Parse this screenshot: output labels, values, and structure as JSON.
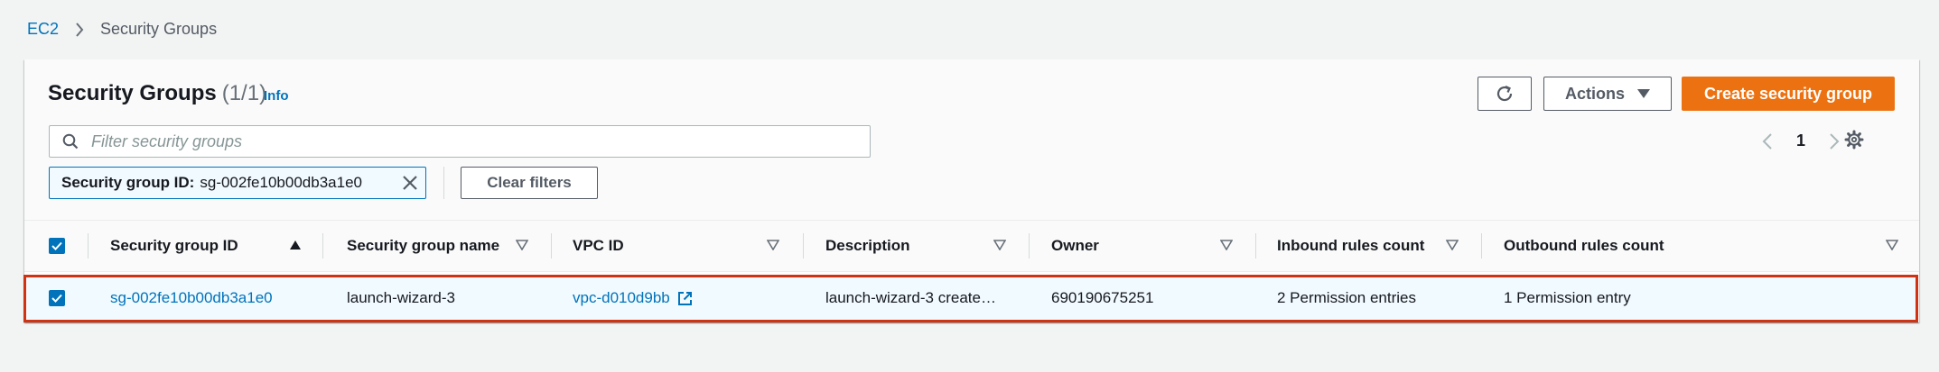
{
  "breadcrumb": {
    "root": "EC2",
    "current": "Security Groups"
  },
  "header": {
    "title": "Security Groups",
    "count": "(1/1)",
    "info": "Info",
    "actions_label": "Actions",
    "create_label": "Create security group"
  },
  "search": {
    "placeholder": "Filter security groups",
    "value": ""
  },
  "pagination": {
    "current_page": "1"
  },
  "filter_token": {
    "key": "Security group ID:",
    "value": "sg-002fe10b00db3a1e0"
  },
  "clear_filters_label": "Clear filters",
  "table": {
    "columns": [
      "Security group ID",
      "Security group name",
      "VPC ID",
      "Description",
      "Owner",
      "Inbound rules count",
      "Outbound rules count"
    ],
    "sorted_column": "Security group ID",
    "sort_direction": "ascending",
    "rows": [
      {
        "selected": true,
        "security_group_id": "sg-002fe10b00db3a1e0",
        "security_group_name": "launch-wizard-3",
        "vpc_id": "vpc-d010d9bb",
        "description": "launch-wizard-3 create…",
        "owner": "690190675251",
        "inbound_rules_count": "2 Permission entries",
        "outbound_rules_count": "1 Permission entry"
      }
    ]
  },
  "colors": {
    "link": "#0073bb",
    "primary": "#ec7211",
    "selection_border": "#d13212",
    "selected_row_bg": "#f1faff"
  },
  "icons": {
    "breadcrumb_separator": "chevron-right-icon",
    "refresh": "refresh-icon",
    "actions": "caret-down-icon",
    "search": "search-icon",
    "pager_prev": "chevron-left-icon",
    "pager_next": "chevron-right-icon",
    "settings": "gear-icon",
    "token_close": "close-icon",
    "external_link": "external-link-icon"
  }
}
